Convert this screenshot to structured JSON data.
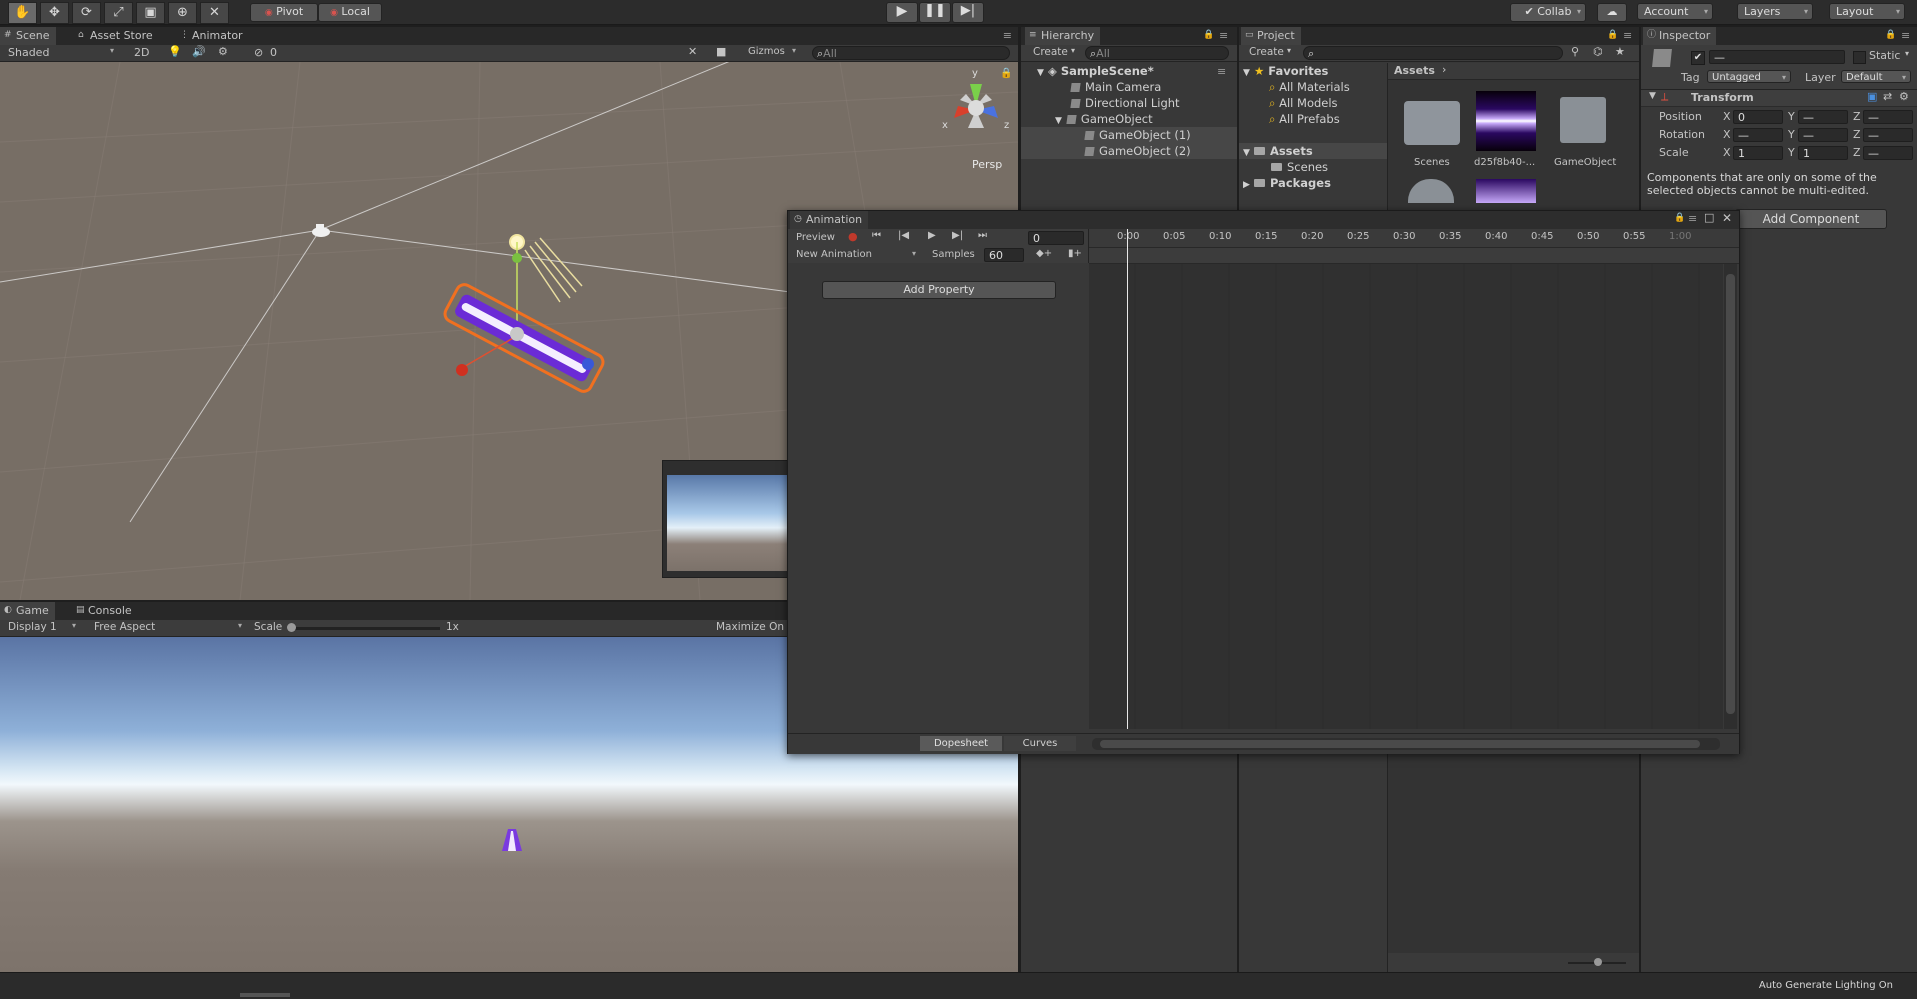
{
  "toolbar": {
    "tools": [
      "hand-icon",
      "move-icon",
      "rotate-icon",
      "scale-icon",
      "rect-icon",
      "transform-icon",
      "custom-tool-icon"
    ],
    "pivot_label": "Pivot",
    "local_label": "Local",
    "collab_label": "Collab",
    "account_label": "Account",
    "layers_label": "Layers",
    "layout_label": "Layout"
  },
  "scene": {
    "tabs": [
      "Scene",
      "Asset Store",
      "Animator"
    ],
    "shading": "Shaded",
    "mode_2d": "2D",
    "gizmos_label": "Gizmos",
    "search_placeholder": "All",
    "hidden_count": "0",
    "persp_label": "Persp",
    "gizmo_axes": {
      "y": "y",
      "x": "x",
      "z": "z"
    }
  },
  "game": {
    "tabs": [
      "Game",
      "Console"
    ],
    "display": "Display 1",
    "aspect": "Free Aspect",
    "scale_label": "Scale",
    "scale_value": "1x",
    "maximize_label": "Maximize On P"
  },
  "hierarchy": {
    "title": "Hierarchy",
    "create_label": "Create",
    "search_placeholder": "All",
    "scene_name": "SampleScene*",
    "items": [
      "Main Camera",
      "Directional Light",
      "GameObject",
      "GameObject (1)",
      "GameObject (2)"
    ]
  },
  "project": {
    "title": "Project",
    "create_label": "Create",
    "favorites_label": "Favorites",
    "favorites": [
      "All Materials",
      "All Models",
      "All Prefabs"
    ],
    "assets_label": "Assets",
    "assets_children": [
      "Scenes"
    ],
    "packages_label": "Packages",
    "breadcrumb": "Assets",
    "grid_items": [
      "Scenes",
      "d25f8b40-...",
      "GameObject"
    ]
  },
  "inspector": {
    "title": "Inspector",
    "static_label": "Static",
    "tag_label": "Tag",
    "tag_value": "Untagged",
    "layer_label": "Layer",
    "layer_value": "Default",
    "transform_label": "Transform",
    "rows": [
      {
        "label": "Position",
        "x": "0",
        "y": "—",
        "z": "—"
      },
      {
        "label": "Rotation",
        "x": "—",
        "y": "—",
        "z": "—"
      },
      {
        "label": "Scale",
        "x": "1",
        "y": "1",
        "z": "—"
      }
    ],
    "axis_x": "X",
    "axis_y": "Y",
    "axis_z": "Z",
    "note": "Components that are only on some of the selected objects cannot be multi-edited.",
    "add_component_label": "Add Component"
  },
  "animation": {
    "title": "Animation",
    "preview_label": "Preview",
    "frame": "0",
    "clip_name": "New Animation",
    "samples_label": "Samples",
    "samples_value": "60",
    "add_property_label": "Add Property",
    "dopesheet_label": "Dopesheet",
    "curves_label": "Curves",
    "ruler": [
      "0:00",
      "0:05",
      "0:10",
      "0:15",
      "0:20",
      "0:25",
      "0:30",
      "0:35",
      "0:40",
      "0:45",
      "0:50",
      "0:55",
      "1:00"
    ]
  },
  "status": {
    "lighting": "Auto Generate Lighting On"
  },
  "colors": {
    "selection_outline": "#f07020",
    "record": "#c0392b",
    "accent_blue": "#3e7ce0"
  }
}
